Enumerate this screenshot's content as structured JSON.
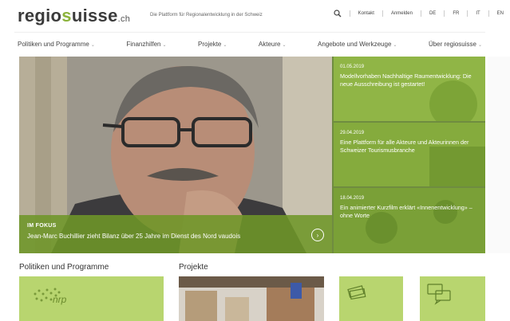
{
  "header": {
    "logo_left": "regio",
    "logo_accent": "s",
    "logo_right": "uisse",
    "logo_suffix": ".ch",
    "tagline": "Die Plattform für Regionalentwicklung in der Schweiz",
    "utility": {
      "contact": "Kontakt",
      "login": "Anmelden",
      "languages": [
        "DE",
        "FR",
        "IT",
        "EN"
      ]
    }
  },
  "nav": {
    "items": [
      "Politiken und Programme",
      "Finanzhilfen",
      "Projekte",
      "Akteure",
      "Angebote und Werkzeuge",
      "Über regiosuisse"
    ]
  },
  "hero": {
    "focus_label": "IM FOKUS",
    "focus_title": "Jean-Marc Buchillier zieht Bilanz über 25 Jahre im Dienst des Nord vaudois",
    "news": [
      {
        "date": "01.05.2019",
        "title": "Modellvorhaben Nachhaltige Raumentwicklung: Die neue Ausschreibung ist gestartet!"
      },
      {
        "date": "29.04.2019",
        "title": "Eine Plattform für alle Akteure und Akteurinnen der Schweizer Tourismusbranche"
      },
      {
        "date": "18.04.2019",
        "title": "Ein animierter Kurzfilm erklärt «Innenentwicklung» – ohne Worte"
      }
    ]
  },
  "sections": {
    "policies_title": "Politiken und Programme",
    "projects_title": "Projekte",
    "nrp_label": "nrp"
  },
  "colors": {
    "brand_green": "#8bb33a",
    "hero_green": "#7ea436",
    "tile_green": "#b8d56f"
  }
}
